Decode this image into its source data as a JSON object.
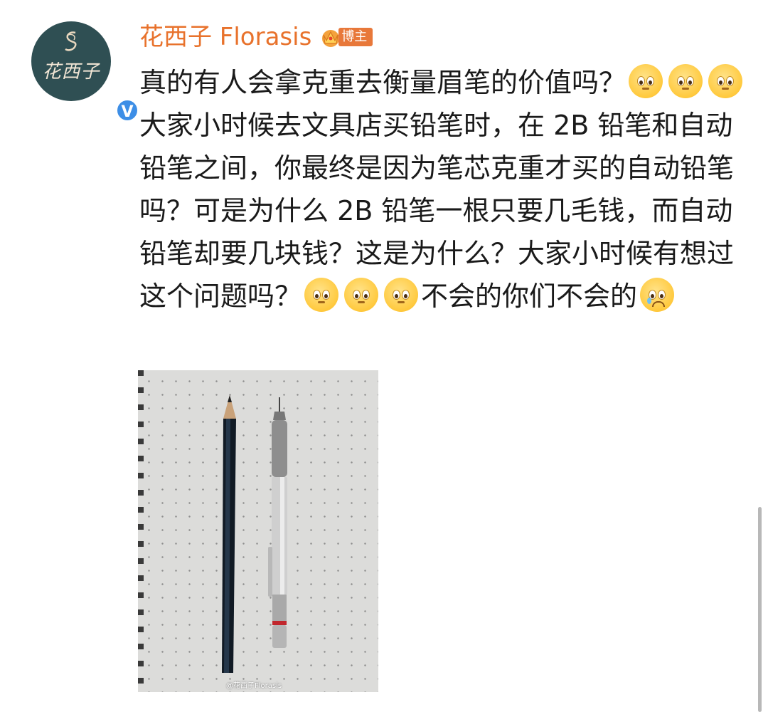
{
  "post": {
    "author": {
      "avatar_text": "花西子",
      "name": "花西子 Florasis",
      "badge_label": "博主"
    },
    "text_segments": [
      {
        "type": "text",
        "value": "真的有人会拿克重去衡量眉笔的价值吗？"
      },
      {
        "type": "emoji",
        "name": "pleading-face"
      },
      {
        "type": "emoji",
        "name": "pleading-face"
      },
      {
        "type": "emoji",
        "name": "pleading-face"
      },
      {
        "type": "text",
        "value": "大家小时候去文具店买铅笔时，在 2B 铅笔和自动铅笔之间，你最终是因为笔芯克重才买的自动铅笔吗？可是为什么 2B 铅笔一根只要几毛钱，而自动铅笔却要几块钱？这是为什么？大家小时候有想过这个问题吗？"
      },
      {
        "type": "emoji",
        "name": "pleading-face"
      },
      {
        "type": "emoji",
        "name": "pleading-face"
      },
      {
        "type": "emoji",
        "name": "pleading-face"
      },
      {
        "type": "text",
        "value": "不会的你们不会的"
      },
      {
        "type": "emoji",
        "name": "crying-sad-face"
      }
    ],
    "image": {
      "watermark": "@花西子Florasis"
    }
  }
}
